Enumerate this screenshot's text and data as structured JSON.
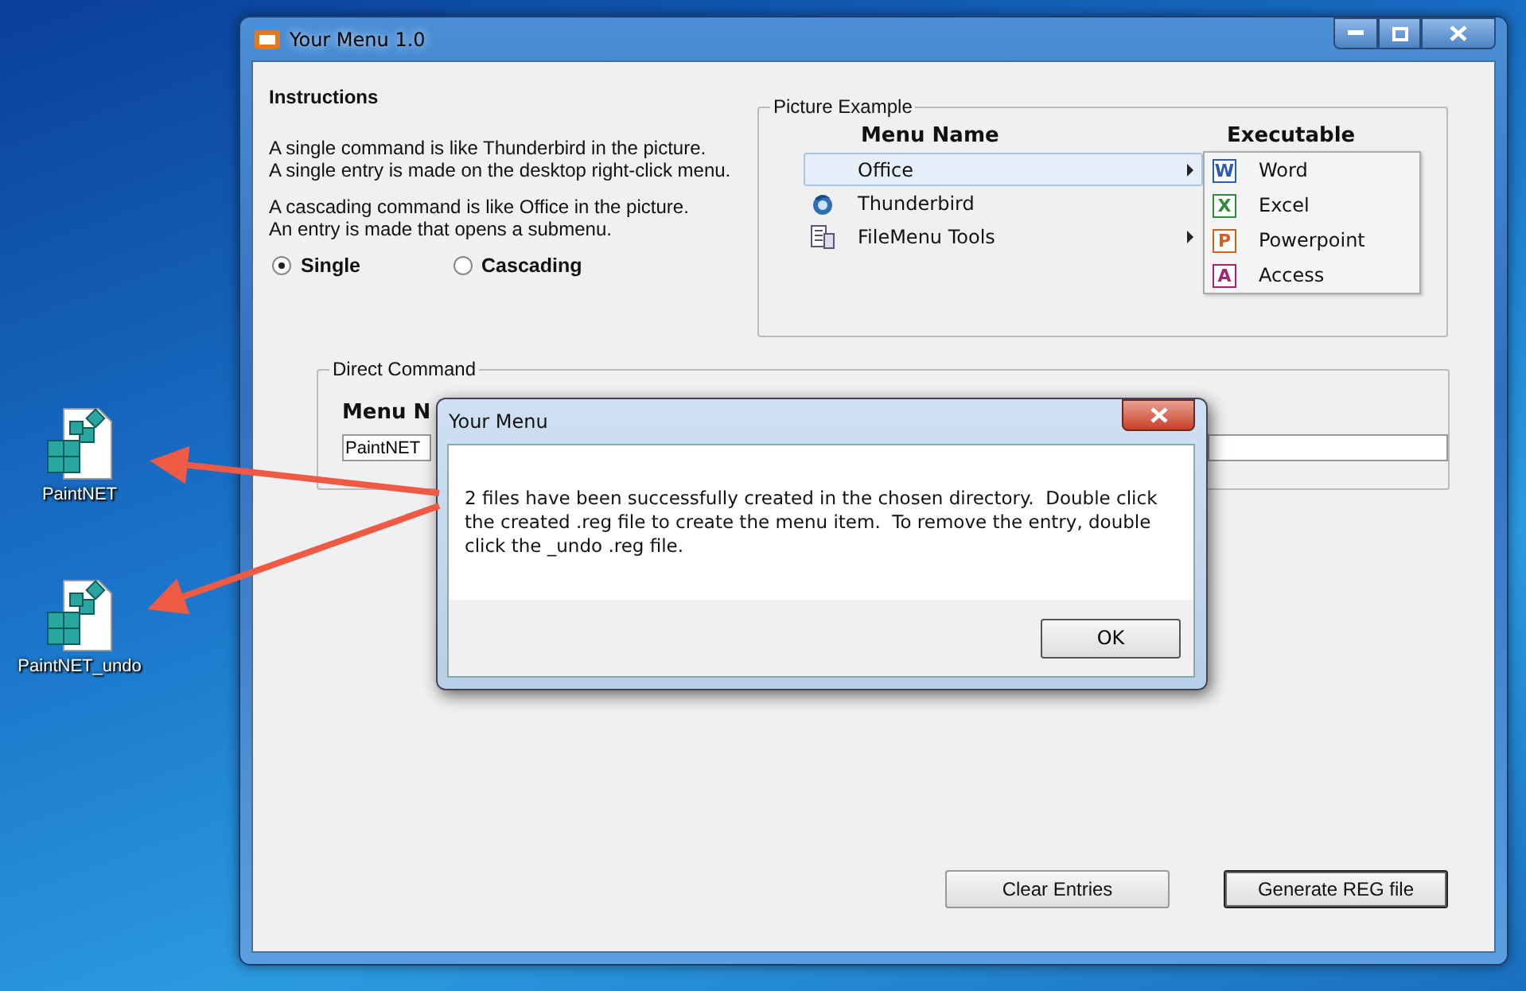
{
  "desktop_icons": [
    {
      "label": "PaintNET"
    },
    {
      "label": "PaintNET_undo"
    }
  ],
  "window": {
    "title": "Your Menu 1.0",
    "instructions": {
      "title": "Instructions",
      "paragraphs": [
        [
          "A single command is like Thunderbird in the picture.",
          "A single entry is made on the desktop right-click menu."
        ],
        [
          "A cascading command is like Office in the picture.",
          "An entry is made that opens a submenu."
        ]
      ]
    },
    "mode_options": [
      {
        "label": "Single",
        "selected": true
      },
      {
        "label": "Cascading",
        "selected": false
      }
    ],
    "picture_example": {
      "title": "Picture Example",
      "menu_header": "Menu Name",
      "executable_header": "Executable",
      "menu_items": [
        {
          "label": "Office",
          "kind": "blank",
          "selected": true,
          "has_submenu": true
        },
        {
          "label": "Thunderbird",
          "kind": "bird",
          "selected": false,
          "has_submenu": false
        },
        {
          "label": "FileMenu Tools",
          "kind": "document",
          "selected": false,
          "has_submenu": true
        }
      ],
      "submenu_items": [
        {
          "label": "Word",
          "icon_letter": "W",
          "color": "#2a5db0"
        },
        {
          "label": "Excel",
          "icon_letter": "X",
          "color": "#2e8b3a"
        },
        {
          "label": "Powerpoint",
          "icon_letter": "P",
          "color": "#d0601a"
        },
        {
          "label": "Access",
          "icon_letter": "A",
          "color": "#a4246f"
        }
      ]
    },
    "direct_command": {
      "title": "Direct Command",
      "menu_name_label": "Menu N",
      "menu_name_value": "PaintNET"
    },
    "buttons": [
      {
        "label": "Clear Entries",
        "default": false
      },
      {
        "label": "Generate REG file",
        "default": true
      }
    ]
  },
  "dialog": {
    "title": "Your Menu",
    "message": "2 files have been successfully created in the chosen directory.  Double click the created .reg file to create the menu item.  To remove the entry, double click the _undo .reg file.",
    "ok_button": "OK"
  }
}
